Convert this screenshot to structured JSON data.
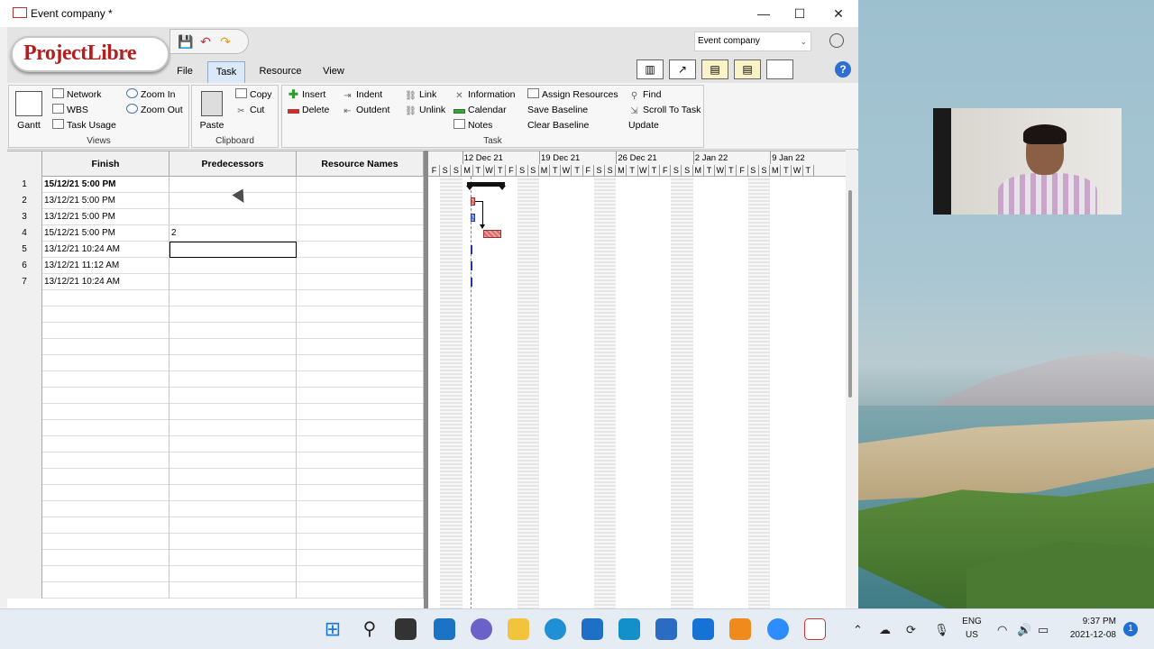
{
  "window": {
    "title": "Event company *",
    "controls": {
      "minimize": "—",
      "maximize": "☐",
      "close": "✕"
    }
  },
  "logo": {
    "text": "ProjectLibre"
  },
  "quick_access": {
    "save_icon": "💾",
    "undo_icon": "↶",
    "redo_icon": "↷"
  },
  "tabs": [
    {
      "label": "File",
      "active": false
    },
    {
      "label": "Task",
      "active": true
    },
    {
      "label": "Resource",
      "active": false
    },
    {
      "label": "View",
      "active": false
    }
  ],
  "project_selector": {
    "value": "Event company",
    "chevron": "⌄"
  },
  "help_label": "?",
  "ribbon": {
    "views": {
      "label": "Views",
      "gantt": "Gantt",
      "network": "Network",
      "wbs": "WBS",
      "task_usage": "Task Usage",
      "zoom_in": "Zoom In",
      "zoom_out": "Zoom Out"
    },
    "clipboard": {
      "label": "Clipboard",
      "paste": "Paste",
      "copy": "Copy",
      "cut": "Cut"
    },
    "task": {
      "label": "Task",
      "insert": "Insert",
      "delete": "Delete",
      "indent": "Indent",
      "outdent": "Outdent",
      "link": "Link",
      "unlink": "Unlink",
      "information": "Information",
      "calendar": "Calendar",
      "notes": "Notes",
      "assign_resources": "Assign Resources",
      "save_baseline": "Save Baseline",
      "clear_baseline": "Clear Baseline",
      "find": "Find",
      "scroll_to_task": "Scroll To Task",
      "update": "Update"
    }
  },
  "grid": {
    "columns": [
      "Finish",
      "Predecessors",
      "Resource Names"
    ],
    "rows": [
      {
        "id": "1",
        "finish": "15/12/21 5:00 PM",
        "predecessors": "",
        "resources": "",
        "bold": true
      },
      {
        "id": "2",
        "finish": "13/12/21 5:00 PM",
        "predecessors": "",
        "resources": "",
        "bold": false
      },
      {
        "id": "3",
        "finish": "13/12/21 5:00 PM",
        "predecessors": "",
        "resources": "",
        "bold": false
      },
      {
        "id": "4",
        "finish": "15/12/21 5:00 PM",
        "predecessors": "2",
        "resources": "",
        "bold": false
      },
      {
        "id": "5",
        "finish": "13/12/21 10:24 AM",
        "predecessors": "",
        "resources": "",
        "bold": false
      },
      {
        "id": "6",
        "finish": "13/12/21 11:12 AM",
        "predecessors": "",
        "resources": "",
        "bold": false
      },
      {
        "id": "7",
        "finish": "13/12/21 10:24 AM",
        "predecessors": "",
        "resources": "",
        "bold": false
      }
    ]
  },
  "gantt": {
    "weeks": [
      "12 Dec 21",
      "19 Dec 21",
      "26 Dec 21",
      "2 Jan 22",
      "9 Jan 22"
    ],
    "day_letters": [
      "F",
      "S",
      "S",
      "M",
      "T",
      "W",
      "T",
      "F",
      "S",
      "S",
      "M",
      "T",
      "W",
      "T",
      "F",
      "S",
      "S",
      "M",
      "T",
      "W",
      "T",
      "F",
      "S",
      "S",
      "M",
      "T",
      "W",
      "T",
      "F",
      "S",
      "S",
      "M",
      "T",
      "W",
      "T"
    ]
  },
  "taskbar": {
    "lang_top": "ENG",
    "lang_bottom": "US",
    "time": "9:37 PM",
    "date": "2021-12-08",
    "notification_count": "1"
  }
}
